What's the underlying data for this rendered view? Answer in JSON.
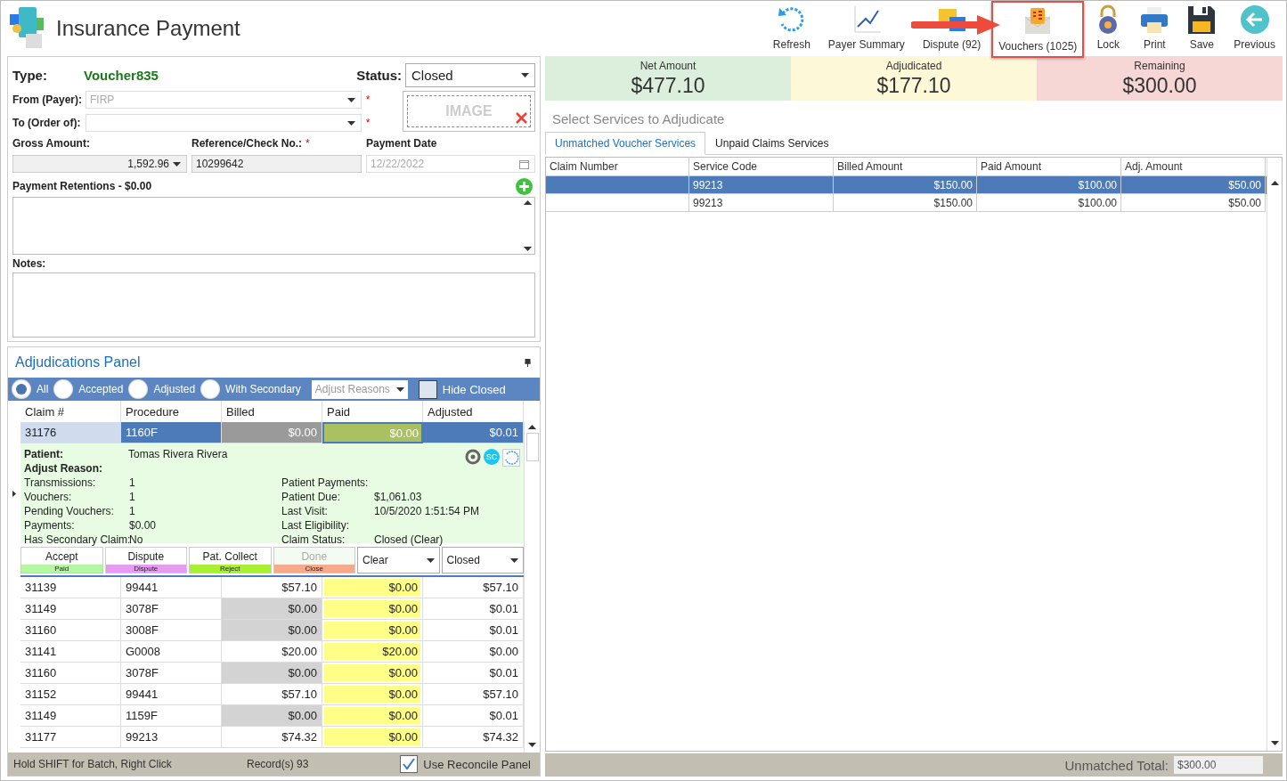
{
  "window": {
    "title": "Insurance Payment"
  },
  "toolbar": [
    {
      "label": "Refresh",
      "highlighted": false
    },
    {
      "label": "Payer Summary",
      "highlighted": false
    },
    {
      "label": "Dispute (92)",
      "highlighted": false
    },
    {
      "label": "Vouchers (1025)",
      "highlighted": true
    },
    {
      "label": "Lock",
      "highlighted": false
    },
    {
      "label": "Print",
      "highlighted": false
    },
    {
      "label": "Save",
      "highlighted": false
    },
    {
      "label": "Previous",
      "highlighted": false
    }
  ],
  "payment": {
    "type_label": "Type:",
    "type_value": "Voucher835",
    "status_label": "Status:",
    "status_value": "Closed",
    "from_label": "From (Payer):",
    "from_value": "FIRP",
    "from_mark": "*",
    "to_label": "To (Order of):",
    "to_mark": "*",
    "image_label": "IMAGE",
    "gross_label": "Gross Amount:",
    "gross_value": "1,592.96",
    "ref_label": "Reference/Check No.:",
    "ref_mark": "*",
    "ref_value": "10299642",
    "date_label": "Payment Date",
    "date_value": "12/22/2022",
    "retentions_label": "Payment Retentions - $0.00",
    "notes_label": "Notes:"
  },
  "adjudications": {
    "title": "Adjudications Panel",
    "filters": [
      {
        "label": "All",
        "selected": true
      },
      {
        "label": "Accepted",
        "selected": false
      },
      {
        "label": "Adjusted",
        "selected": false
      },
      {
        "label": "With Secondary",
        "selected": false
      }
    ],
    "adjust_reasons_placeholder": "Adjust Reasons",
    "hide_closed": {
      "label": "Hide Closed",
      "checked": false
    },
    "columns": [
      "Claim #",
      "Procedure",
      "Billed",
      "Paid",
      "Adjusted"
    ],
    "current": {
      "cells": [
        "31176",
        "1160F",
        "$0.00",
        "$0.00",
        "$0.01"
      ],
      "detail_left": [
        {
          "label": "Patient:",
          "value": "Tomas Rivera Rivera"
        },
        {
          "label": "Adjust Reason:"
        }
      ],
      "detail_col1": [
        {
          "label": "Transmissions:",
          "value": "1"
        },
        {
          "label": "Vouchers:",
          "value": "1"
        },
        {
          "label": "Pending Vouchers:",
          "value": "1"
        },
        {
          "label": "Payments:",
          "value": "$0.00"
        },
        {
          "label": "Has Secondary Claim:",
          "value": "No"
        }
      ],
      "detail_col2": [
        {
          "label": "Patient Payments:"
        },
        {
          "label": "Patient Due:",
          "value": "$1,061.03"
        },
        {
          "label": "Last Visit:",
          "value": "10/5/2020 1:51:54 PM"
        },
        {
          "label": "Last Eligibility:"
        },
        {
          "label": "Claim Status:",
          "value": "Closed  (Clear)"
        }
      ],
      "badge": "SC",
      "actions": [
        {
          "label": "Accept",
          "sublabel": "Paid",
          "color": "#b3f7a0",
          "disabled": false
        },
        {
          "label": "Dispute",
          "sublabel": "Dispute",
          "color": "#e59cf0",
          "disabled": false
        },
        {
          "label": "Pat. Collect",
          "sublabel": "Reject",
          "color": "#a8f030",
          "disabled": false
        },
        {
          "label": "Done",
          "sublabel": "Close",
          "color": "#f7a98c",
          "disabled": true
        }
      ],
      "dropdowns": [
        "Clear",
        "Closed"
      ]
    },
    "rows": [
      {
        "cells": [
          "31139",
          "99441",
          "$57.10",
          "$0.00",
          "$57.10"
        ],
        "billed_shaded": false
      },
      {
        "cells": [
          "31149",
          "3078F",
          "$0.00",
          "$0.00",
          "$0.01"
        ],
        "billed_shaded": true
      },
      {
        "cells": [
          "31160",
          "3008F",
          "$0.00",
          "$0.00",
          "$0.01"
        ],
        "billed_shaded": true
      },
      {
        "cells": [
          "31141",
          "G0008",
          "$20.00",
          "$20.00",
          "$0.00"
        ],
        "billed_shaded": false
      },
      {
        "cells": [
          "31160",
          "3078F",
          "$0.00",
          "$0.00",
          "$0.01"
        ],
        "billed_shaded": true
      },
      {
        "cells": [
          "31152",
          "99441",
          "$57.10",
          "$0.00",
          "$57.10"
        ],
        "billed_shaded": false
      },
      {
        "cells": [
          "31149",
          "1159F",
          "$0.00",
          "$0.00",
          "$0.01"
        ],
        "billed_shaded": true
      },
      {
        "cells": [
          "31177",
          "99213",
          "$74.32",
          "$0.00",
          "$74.32"
        ],
        "billed_shaded": false
      }
    ],
    "footer": {
      "hint": "Hold SHIFT for Batch, Right Click",
      "records": "Record(s) 93",
      "reconcile": {
        "label": "Use Reconcile Panel",
        "checked": true
      }
    }
  },
  "summary": [
    {
      "label": "Net Amount",
      "value": "$477.10",
      "color": "#dcefdc"
    },
    {
      "label": "Adjudicated",
      "value": "$177.10",
      "color": "#fdf8d8"
    },
    {
      "label": "Remaining",
      "value": "$300.00",
      "color": "#f7d6d6"
    }
  ],
  "services": {
    "title": "Select Services to Adjudicate",
    "tabs": [
      {
        "label": "Unmatched Voucher Services",
        "selected": true
      },
      {
        "label": "Unpaid Claims Services",
        "selected": false
      }
    ],
    "columns": [
      "Claim Number",
      "Service Code",
      "Billed Amount",
      "Paid Amount",
      "Adj. Amount"
    ],
    "rows": [
      {
        "cells": [
          "",
          "99213",
          "$150.00",
          "$100.00",
          "$50.00"
        ],
        "selected": true
      },
      {
        "cells": [
          "",
          "99213",
          "$150.00",
          "$100.00",
          "$50.00"
        ],
        "selected": false
      }
    ],
    "unmatched_label": "Unmatched Total:",
    "unmatched_value": "$300.00"
  }
}
